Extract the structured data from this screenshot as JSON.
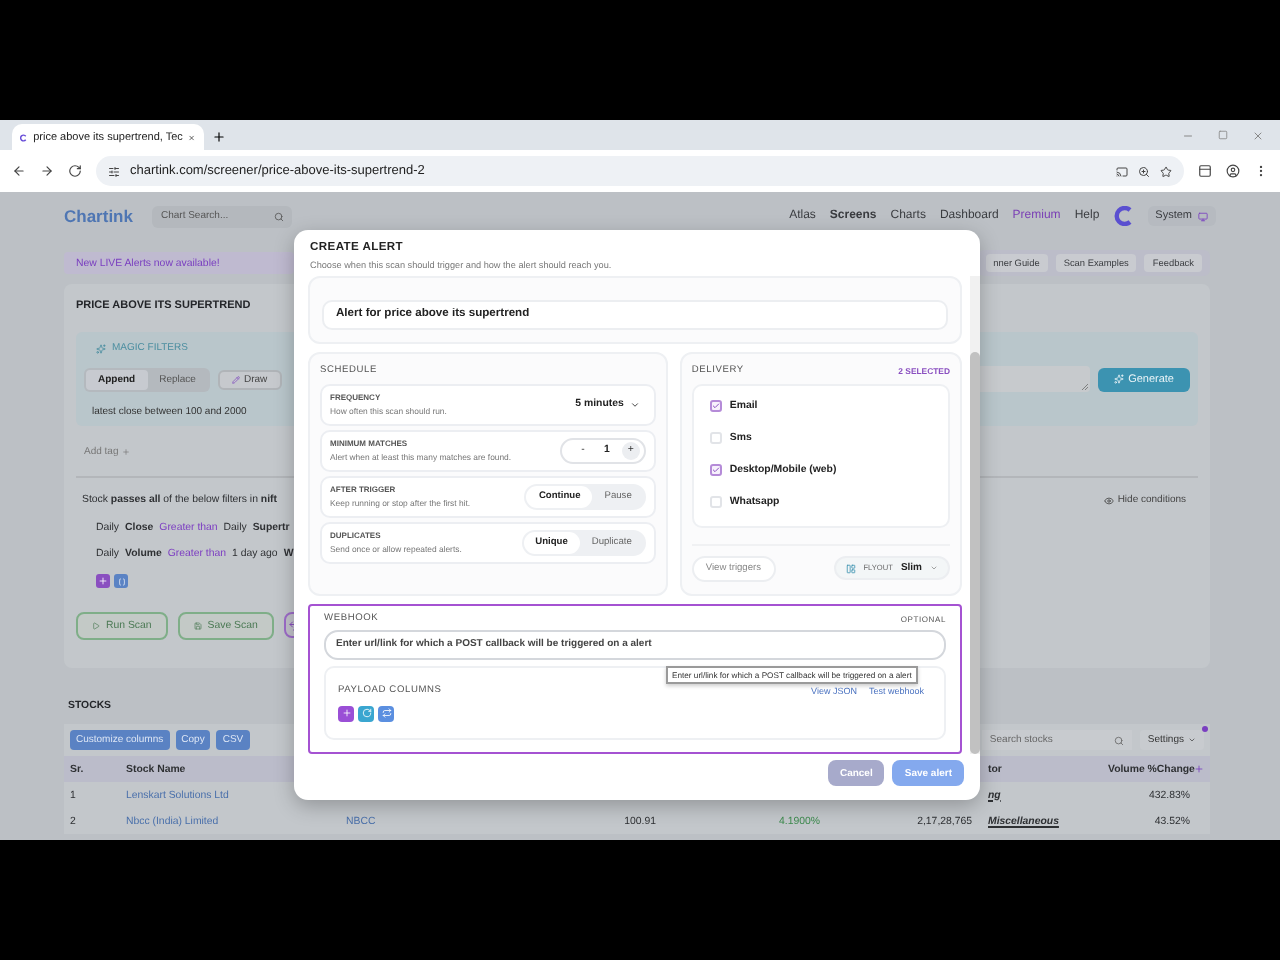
{
  "browser": {
    "tab_title": "price above its supertrend, Tec",
    "url": "chartink.com/screener/price-above-its-supertrend-2"
  },
  "nav": {
    "logo": "Chartink",
    "search_placeholder": "Chart Search...",
    "links": [
      {
        "label": "Atlas",
        "kind": "link",
        "selected": false
      },
      {
        "label": "Screens",
        "kind": "link",
        "selected": true
      },
      {
        "label": "Charts",
        "kind": "link",
        "selected": false
      },
      {
        "label": "Dashboard",
        "kind": "link",
        "selected": false
      },
      {
        "label": "Premium",
        "kind": "premium",
        "selected": false
      },
      {
        "label": "Help",
        "kind": "link",
        "selected": false
      }
    ],
    "theme": "System"
  },
  "screener": {
    "banner": "New LIVE Alerts now available!",
    "guide_buttons": [
      "nner Guide",
      "Scan Examples",
      "Feedback"
    ],
    "title": "PRICE ABOVE ITS SUPERTREND",
    "magic_filters": {
      "label": "MAGIC FILTERS",
      "modes": [
        {
          "label": "Append",
          "selected": true
        },
        {
          "label": "Replace",
          "selected": false
        }
      ],
      "draw": "Draw",
      "generate": "Generate",
      "prompt": "latest close between 100 and 2000"
    },
    "add_tag": "Add tag",
    "hide_conditions": "Hide conditions",
    "filter_intro": "Stock **passes all** of the below filters in **nift**",
    "conditions": [
      [
        {
          "text": "Daily",
          "kind": "plain"
        },
        {
          "text": "Close",
          "kind": "field"
        },
        {
          "text": "Greater than",
          "kind": "operator"
        },
        {
          "text": "Daily",
          "kind": "plain"
        },
        {
          "text": "Supertr",
          "kind": "field"
        }
      ],
      [
        {
          "text": "Daily",
          "kind": "plain"
        },
        {
          "text": "Volume",
          "kind": "field"
        },
        {
          "text": "Greater than",
          "kind": "operator"
        },
        {
          "text": "1 day ago",
          "kind": "plain"
        },
        {
          "text": "W",
          "kind": "field"
        }
      ]
    ],
    "scan_buttons": [
      "Run Scan",
      "Save Scan"
    ]
  },
  "stocks": {
    "title": "STOCKS",
    "tools": [
      "Customize columns",
      "Copy",
      "CSV"
    ],
    "search_placeholder": "Search stocks",
    "settings": "Settings",
    "columns": {
      "sr": "Sr.",
      "name": "Stock Name",
      "sector": "tor",
      "volume_change": "Volume %Change"
    },
    "rows": [
      {
        "sr": "1",
        "name": "Lenskart Solutions Ltd",
        "sector": "ng",
        "volume_change": "432.83%"
      },
      {
        "sr": "2",
        "name": "Nbcc (India) Limited",
        "symbol": "NBCC",
        "price": "100.91",
        "change": "4.1900%",
        "volume": "2,17,28,765",
        "sector": "Miscellaneous",
        "volume_change": "43.52%"
      }
    ]
  },
  "alert": {
    "title": "CREATE ALERT",
    "subtitle": "Choose when this scan should trigger and how the alert should reach you.",
    "name": "Alert for price above its supertrend",
    "schedule": {
      "title": "SCHEDULE",
      "settings": [
        {
          "kind": "select",
          "label": "FREQUENCY",
          "hint": "How often this scan should run.",
          "value": "5 minutes"
        },
        {
          "kind": "stepper",
          "label": "MINIMUM MATCHES",
          "hint": "Alert when at least this many matches are found.",
          "value": "1",
          "decrement": "-",
          "increment": "+"
        },
        {
          "kind": "toggle",
          "label": "AFTER TRIGGER",
          "hint": "Keep running or stop after the first hit.",
          "options": [
            {
              "label": "Continue",
              "selected": true
            },
            {
              "label": "Pause",
              "selected": false
            }
          ]
        },
        {
          "kind": "toggle",
          "label": "DUPLICATES",
          "hint": "Send once or allow repeated alerts.",
          "options": [
            {
              "label": "Unique",
              "selected": true
            },
            {
              "label": "Duplicate",
              "selected": false
            }
          ]
        }
      ]
    },
    "delivery": {
      "title": "DELIVERY",
      "count": "2 SELECTED",
      "channels": [
        {
          "label": "Email",
          "checked": true
        },
        {
          "label": "Sms",
          "checked": false
        },
        {
          "label": "Desktop/Mobile (web)",
          "checked": true
        },
        {
          "label": "Whatsapp",
          "checked": false
        }
      ],
      "view_triggers": "View triggers",
      "flyout_label": "FLYOUT",
      "flyout_value": "Slim"
    },
    "webhook": {
      "title": "WEBHOOK",
      "badge": "OPTIONAL",
      "placeholder": "Enter url/link for which a POST callback will be triggered on a alert",
      "tooltip": "Enter url/link for which a POST callback will be triggered on a alert",
      "payload_title": "PAYLOAD COLUMNS",
      "links": [
        "View JSON",
        "Test webhook"
      ]
    },
    "buttons": [
      {
        "label": "Cancel",
        "kind": "secondary"
      },
      {
        "label": "Save alert",
        "kind": "primary"
      }
    ]
  }
}
